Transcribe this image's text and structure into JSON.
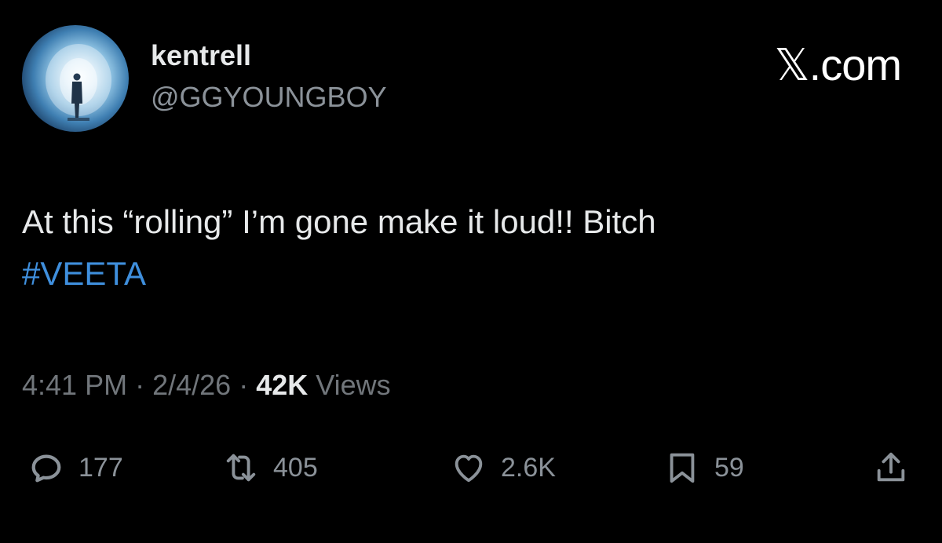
{
  "author": {
    "display_name": "kentrell",
    "handle": "@GGYOUNGBOY",
    "avatar_icon": "profile-photo"
  },
  "brand": {
    "label": "𝕏.com"
  },
  "tweet": {
    "text": "At this “rolling” I’m gone make it loud!! Bitch",
    "hashtag": "#VEETA"
  },
  "meta": {
    "time": "4:41 PM",
    "separator": "·",
    "date": "2/4/26",
    "views_count": "42K",
    "views_label": "Views"
  },
  "actions": {
    "reply": {
      "icon": "reply-icon",
      "count": "177"
    },
    "repost": {
      "icon": "repost-icon",
      "count": "405"
    },
    "like": {
      "icon": "heart-icon",
      "count": "2.6K"
    },
    "bookmark": {
      "icon": "bookmark-icon",
      "count": "59"
    },
    "share": {
      "icon": "share-icon"
    }
  },
  "colors": {
    "background": "#000000",
    "primary_text": "#e7e9ea",
    "secondary_text": "#71767b",
    "hashtag": "#3f8fdd"
  }
}
